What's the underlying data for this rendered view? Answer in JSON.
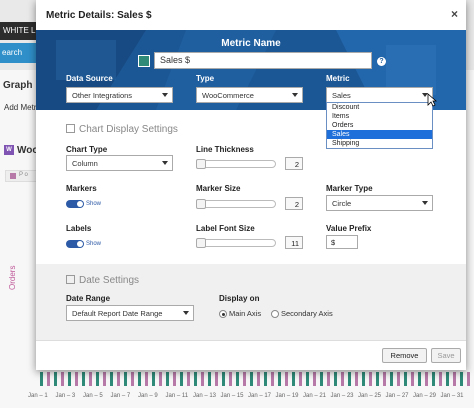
{
  "background": {
    "white_label_button": "WHITE L",
    "search_button": "earch",
    "graph_heading": "Graph",
    "add_metric_link": "Add Metr",
    "woo_badge": "W",
    "woo_heading": "Woo",
    "legend_text": "P o",
    "y_axis_label": "Orders",
    "x_labels": [
      "Jan – 1",
      "Jan – 3",
      "Jan – 5",
      "Jan – 7",
      "Jan – 9",
      "Jan – 11",
      "Jan – 13",
      "Jan – 15",
      "Jan – 17",
      "Jan – 19",
      "Jan – 21",
      "Jan – 23",
      "Jan – 25",
      "Jan – 27",
      "Jan – 29",
      "Jan – 31"
    ]
  },
  "modal": {
    "title": "Metric Details: Sales $",
    "close_glyph": "×",
    "banner": {
      "metric_name_label": "Metric Name",
      "metric_name_value": "Sales $",
      "color_swatch": "#2f8a78",
      "help_glyph": "?",
      "data_source_label": "Data Source",
      "data_source_value": "Other Integrations",
      "type_label": "Type",
      "type_value": "WooCommerce",
      "metric_label": "Metric",
      "metric_value": "Sales",
      "metric_options": [
        "Discount",
        "Items",
        "Orders",
        "Sales",
        "Shipping"
      ],
      "metric_selected_index": 3
    },
    "chart_display": {
      "section_title": "Chart Display Settings",
      "chart_type_label": "Chart Type",
      "chart_type_value": "Column",
      "line_thickness_label": "Line Thickness",
      "line_thickness_value": "2",
      "markers_label": "Markers",
      "markers_toggle_text": "Show",
      "marker_size_label": "Marker Size",
      "marker_size_value": "2",
      "marker_type_label": "Marker Type",
      "marker_type_value": "Circle",
      "labels_label": "Labels",
      "labels_toggle_text": "Show",
      "label_font_size_label": "Label Font Size",
      "label_font_size_value": "11",
      "value_prefix_label": "Value Prefix",
      "value_prefix_value": "$"
    },
    "date_settings": {
      "section_title": "Date Settings",
      "date_range_label": "Date Range",
      "date_range_value": "Default Report Date Range",
      "display_on_label": "Display on",
      "main_axis_label": "Main Axis",
      "secondary_axis_label": "Secondary Axis",
      "main_axis_selected": true
    },
    "footer": {
      "remove_label": "Remove",
      "save_label": "Save"
    }
  }
}
